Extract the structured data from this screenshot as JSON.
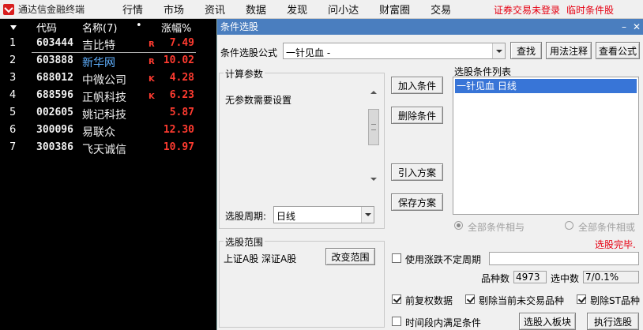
{
  "app": {
    "title": "通达信金融终端"
  },
  "menu": [
    "行情",
    "市场",
    "资讯",
    "数据",
    "发现",
    "问小达",
    "财富圈",
    "交易"
  ],
  "status": {
    "login": "证券交易未登录",
    "condition": "临时条件股"
  },
  "quote_table": {
    "headers": {
      "code": "代码",
      "name": "名称(7)",
      "dot": "•",
      "pct": "涨幅%"
    },
    "rows": [
      {
        "idx": "1",
        "code": "603444",
        "name": "吉比特",
        "flag": "R",
        "pct": "7.49"
      },
      {
        "idx": "2",
        "code": "603888",
        "name": "新华网",
        "flag": "R",
        "pct": "10.02"
      },
      {
        "idx": "3",
        "code": "688012",
        "name": "中微公司",
        "flag": "K",
        "pct": "4.28"
      },
      {
        "idx": "4",
        "code": "688596",
        "name": "正帆科技",
        "flag": "K",
        "pct": "6.23"
      },
      {
        "idx": "5",
        "code": "002605",
        "name": "姚记科技",
        "flag": "",
        "pct": "5.87"
      },
      {
        "idx": "6",
        "code": "300096",
        "name": "易联众",
        "flag": "",
        "pct": "12.30"
      },
      {
        "idx": "7",
        "code": "300386",
        "name": "飞天诚信",
        "flag": "",
        "pct": "10.97"
      }
    ],
    "colors": {
      "up": "#ff3b30",
      "name_highlight": "#5fb0ff"
    }
  },
  "dialog": {
    "title": "条件选股",
    "controls": {
      "minimize": "–",
      "close": "✕"
    },
    "formula_label": "条件选股公式",
    "formula_value": "一针见血  -",
    "find_button": "查找",
    "usage_button": "用法注释",
    "view_button": "查看公式",
    "params_group": "计算参数",
    "params_text": "无参数需要设置",
    "period_label": "选股周期:",
    "period_value": "日线",
    "add_button": "加入条件",
    "delete_button": "删除条件",
    "import_button": "引入方案",
    "save_button": "保存方案",
    "cond_list_label": "选股条件列表",
    "cond_list_items": [
      "一针见血  日线"
    ],
    "radio_and": "全部条件相与",
    "radio_or": "全部条件相或",
    "done_text": "选股完毕.",
    "range_group": "选股范围",
    "range_text": "上证A股 深证A股",
    "range_button": "改变范围",
    "use_period_label": "使用涨跌不定周期",
    "count_label": "品种数",
    "count_value": "4973",
    "selected_label": "选中数",
    "selected_value": "7/0.1%",
    "check_adjusted": "前复权数据",
    "check_exclude_untraded": "剔除当前未交易品种",
    "check_exclude_st": "剔除ST品种",
    "check_time_range": "时间段内满足条件",
    "to_block_button": "选股入板块",
    "run_button": "执行选股"
  }
}
